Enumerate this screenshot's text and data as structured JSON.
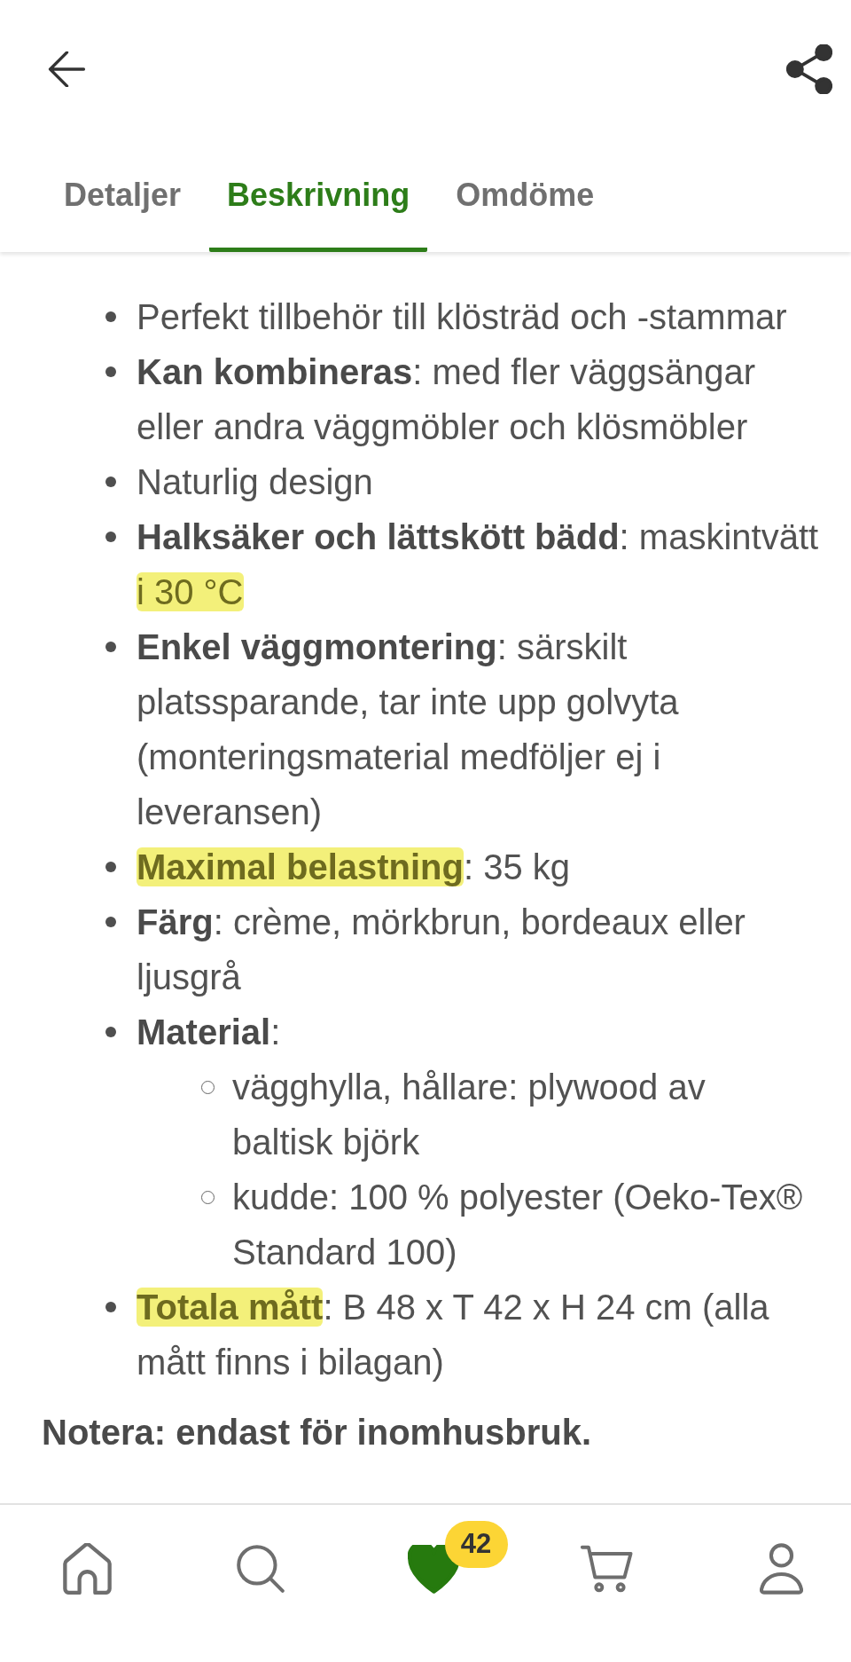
{
  "header": {
    "tabs": [
      {
        "label": "Detaljer",
        "selected": false
      },
      {
        "label": "Beskrivning",
        "selected": true
      },
      {
        "label": "Omdöme",
        "selected": false
      }
    ]
  },
  "description": {
    "items": [
      {
        "parts": [
          {
            "text": "Perfekt tillbehör till klösträd och -stammar",
            "bold": false,
            "highlight": false
          }
        ]
      },
      {
        "parts": [
          {
            "text": "Kan kombineras",
            "bold": true,
            "highlight": false
          },
          {
            "text": ": med fler väggsängar eller andra väggmöbler och klösmöbler",
            "bold": false,
            "highlight": false
          }
        ]
      },
      {
        "parts": [
          {
            "text": "Naturlig design",
            "bold": false,
            "highlight": false
          }
        ]
      },
      {
        "parts": [
          {
            "text": "Halksäker och lättskött bädd",
            "bold": true,
            "highlight": false
          },
          {
            "text": ": maskintvätt ",
            "bold": false,
            "highlight": false
          },
          {
            "text": "i 30 °C",
            "bold": false,
            "highlight": true
          }
        ]
      },
      {
        "parts": [
          {
            "text": "Enkel väggmontering",
            "bold": true,
            "highlight": false
          },
          {
            "text": ": särskilt platssparande, tar inte upp golvyta (monteringsmaterial medföljer ej i leveransen)",
            "bold": false,
            "highlight": false
          }
        ]
      },
      {
        "parts": [
          {
            "text": "Maximal belastning",
            "bold": true,
            "highlight": true
          },
          {
            "text": ": 35 kg",
            "bold": false,
            "highlight": false
          }
        ]
      },
      {
        "parts": [
          {
            "text": "Färg",
            "bold": true,
            "highlight": false
          },
          {
            "text": ": crème, mörkbrun, bordeaux eller ljusgrå",
            "bold": false,
            "highlight": false
          }
        ]
      },
      {
        "parts": [
          {
            "text": "Material",
            "bold": true,
            "highlight": false
          },
          {
            "text": ":",
            "bold": false,
            "highlight": false
          }
        ],
        "children": [
          {
            "parts": [
              {
                "text": "vägghylla, hållare: plywood av baltisk björk",
                "bold": false,
                "highlight": false
              }
            ]
          },
          {
            "parts": [
              {
                "text": "kudde: 100 % polyester (Oeko-Tex® Standard 100)",
                "bold": false,
                "highlight": false
              }
            ]
          }
        ]
      },
      {
        "parts": [
          {
            "text": "Totala mått",
            "bold": true,
            "highlight": true
          },
          {
            "text": ": B 48 x T 42 x H 24 cm (alla mått finns i bilagan)",
            "bold": false,
            "highlight": false
          }
        ]
      }
    ],
    "note": "Notera: endast för inomhusbruk."
  },
  "bottom_nav": {
    "items": [
      {
        "kind": "home",
        "selected": false
      },
      {
        "kind": "search",
        "selected": false
      },
      {
        "kind": "favorites",
        "selected": true,
        "badge": "42"
      },
      {
        "kind": "cart",
        "selected": false
      },
      {
        "kind": "account",
        "selected": false
      }
    ]
  }
}
